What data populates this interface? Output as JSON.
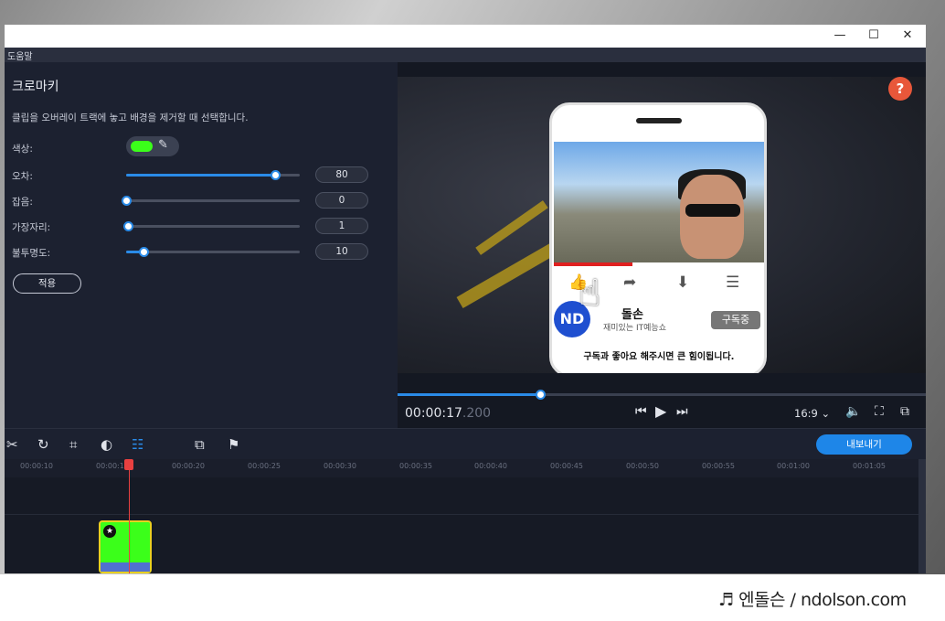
{
  "window": {
    "minimize_glyph": "—",
    "maximize_glyph": "☐",
    "close_glyph": "✕"
  },
  "menu": {
    "help": "도움말"
  },
  "chroma": {
    "title": "크로마키",
    "description": "클립을 오버레이 트랙에 놓고 배경을 제거할 때 선택합니다.",
    "color_label": "색상:",
    "color_value": "#3bff1a",
    "sliders": [
      {
        "label": "오차:",
        "value": "80",
        "fraction": 0.86
      },
      {
        "label": "잡음:",
        "value": "0",
        "fraction": 0.0
      },
      {
        "label": "가장자리:",
        "value": "1",
        "fraction": 0.01
      },
      {
        "label": "불투명도:",
        "value": "10",
        "fraction": 0.1
      }
    ],
    "apply_label": "적용"
  },
  "phone": {
    "logo_text": "ND",
    "channel_name": "돌손",
    "channel_sub": "재미있는 IT예능쇼",
    "subscribe_label": "구독중",
    "caption": "구독과 좋아요 해주시면 큰 힘이됩니다."
  },
  "player": {
    "help_glyph": "?",
    "timecode_main": "00:00:17",
    "timecode_ms": ".200",
    "progress": 0.27,
    "aspect": "16:9 ⌄"
  },
  "toolbar": {
    "export_label": "내보내기"
  },
  "ruler": [
    "00:00:10",
    "00:00:1",
    "00:00:20",
    "00:00:25",
    "00:00:30",
    "00:00:35",
    "00:00:40",
    "00:00:45",
    "00:00:50",
    "00:00:55",
    "00:01:00",
    "00:01:05"
  ],
  "watermark": "♬ 엔돌슨 / ndolson.com"
}
